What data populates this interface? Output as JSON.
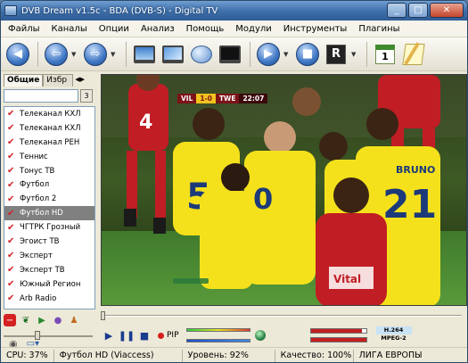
{
  "window": {
    "title": "DVB Dream v1.5c - BDA (DVB-S) - Digital TV",
    "controls": {
      "minimize": "_",
      "maximize": "□",
      "close": "✕"
    }
  },
  "menu": [
    "Файлы",
    "Каналы",
    "Опции",
    "Анализ",
    "Помощь",
    "Модули",
    "Инструменты",
    "Плагины"
  ],
  "toolbar": {
    "icons": [
      "back-icon",
      "prev-channel-icon",
      "next-channel-icon",
      "monitor-icon",
      "satellite-view-icon",
      "mouse-icon",
      "record-screen-icon",
      "play-icon",
      "stop-icon",
      "recorder-icon",
      "calendar-icon",
      "notes-icon"
    ],
    "calendar_day": "1",
    "recorder_letter": "R"
  },
  "sidebar": {
    "tabs": {
      "general": "Общие",
      "favorites": "Избр"
    },
    "search": {
      "value": "",
      "button": "3"
    },
    "channels": [
      {
        "name": "Телеканал КХЛ",
        "selected": false
      },
      {
        "name": "Телеканал КХЛ",
        "selected": false
      },
      {
        "name": "Телеканал РЕН",
        "selected": false
      },
      {
        "name": "Теннис",
        "selected": false
      },
      {
        "name": "Тонус ТВ",
        "selected": false
      },
      {
        "name": "Футбол",
        "selected": false
      },
      {
        "name": "Футбол 2",
        "selected": false
      },
      {
        "name": "Футбол HD",
        "selected": true
      },
      {
        "name": "ЧГТРК Грозный",
        "selected": false
      },
      {
        "name": "Эгоист ТВ",
        "selected": false
      },
      {
        "name": "Эксперт",
        "selected": false
      },
      {
        "name": "Эксперт ТВ",
        "selected": false
      },
      {
        "name": "Южный Регион",
        "selected": false
      },
      {
        "name": "Arb Radio",
        "selected": false
      }
    ],
    "check_glyph": "✔"
  },
  "video": {
    "scoreboard": {
      "home": "VIL",
      "score": "1-0",
      "away": "TWE",
      "clock": "22:07"
    }
  },
  "player": {
    "pip_label": "PIP",
    "video_codec": "H.264",
    "audio_codec": "MPEG-2",
    "signal_level": 0.92,
    "signal_quality": 1.0
  },
  "status": {
    "cpu": "CPU: 37%",
    "channel": "Футбол HD (Viaccess)",
    "level": "Уровень: 92%",
    "quality": "Качество: 100%",
    "program": "ЛИГА ЕВРОПЫ"
  },
  "colors": {
    "accent": "#3e6ea8",
    "check": "#d1232a",
    "jersey": "#f4e11c"
  }
}
